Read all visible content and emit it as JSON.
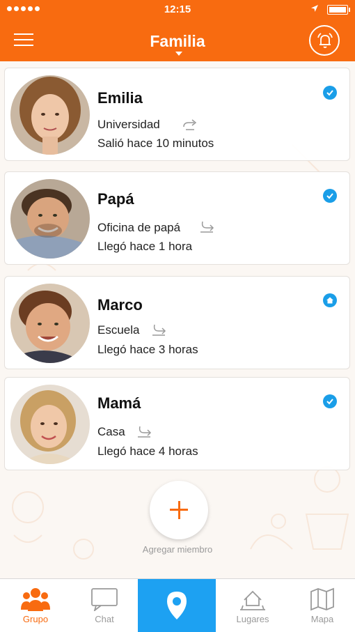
{
  "status_bar": {
    "time": "12:15"
  },
  "header": {
    "title": "Familia"
  },
  "members": [
    {
      "name": "Emilia",
      "place": "Universidad",
      "status": "Salió hace 10 minutos",
      "badge": "check-icon"
    },
    {
      "name": "Papá",
      "place": "Oficina de papá",
      "status": "Llegó hace 1 hora",
      "badge": "check-icon"
    },
    {
      "name": "Marco",
      "place": "Escuela",
      "status": "Llegó hace 3 horas",
      "badge": "home-icon"
    },
    {
      "name": "Mamá",
      "place": "Casa",
      "status": "Llegó hace 4 horas",
      "badge": "check-icon"
    }
  ],
  "add_member": {
    "label": "Agregar miembro"
  },
  "tabs": [
    {
      "label": "Grupo",
      "icon": "group-icon",
      "active": true
    },
    {
      "label": "Chat",
      "icon": "chat-icon"
    },
    {
      "label": "",
      "icon": "location-pin-icon"
    },
    {
      "label": "Lugares",
      "icon": "places-icon"
    },
    {
      "label": "Mapa",
      "icon": "map-icon"
    }
  ],
  "colors": {
    "primary": "#f86b10",
    "accent_blue": "#1da1f2",
    "badge_blue": "#1a9ee8"
  }
}
